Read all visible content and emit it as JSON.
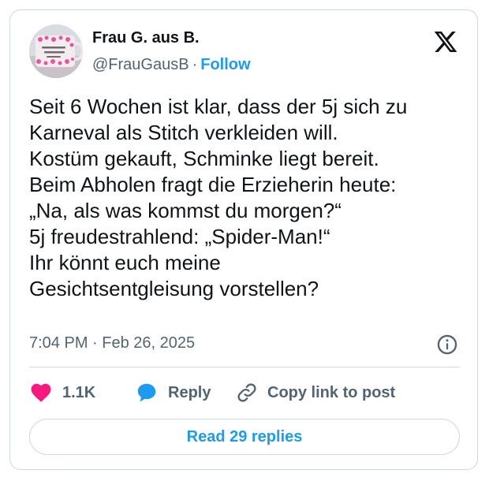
{
  "author": {
    "name": "Frau G. aus B.",
    "handle": "@FrauGausB",
    "separator": "·",
    "follow_label": "Follow",
    "avatar_mug_text": "ICH BIN NUR ZUM KAFFEE HIER"
  },
  "tweet": {
    "lines": [
      "Seit 6 Wochen ist klar, dass der 5j sich zu",
      "Karneval als Stitch verkleiden will.",
      "Kostüm gekauft, Schminke liegt bereit.",
      "Beim Abholen fragt die Erzieherin heute:",
      "„Na, als was kommst du morgen?“",
      "5j freudestrahlend: „Spider-Man!“",
      "Ihr könnt euch meine",
      "Gesichtsentgleisung vorstellen?"
    ],
    "timestamp": "7:04 PM · Feb 26, 2025"
  },
  "actions": {
    "like_count": "1.1K",
    "reply_label": "Reply",
    "copy_link_label": "Copy link to post"
  },
  "read_replies_label": "Read 29 replies",
  "colors": {
    "accent": "#1d9bf0",
    "like": "#f91880",
    "text": "#0f1419",
    "muted": "#536471",
    "border": "#cfd9de"
  },
  "icons": {
    "logo": "x-logo-icon",
    "info": "info-icon",
    "like": "heart-icon",
    "reply": "speech-bubble-icon",
    "copy_link": "link-icon"
  }
}
